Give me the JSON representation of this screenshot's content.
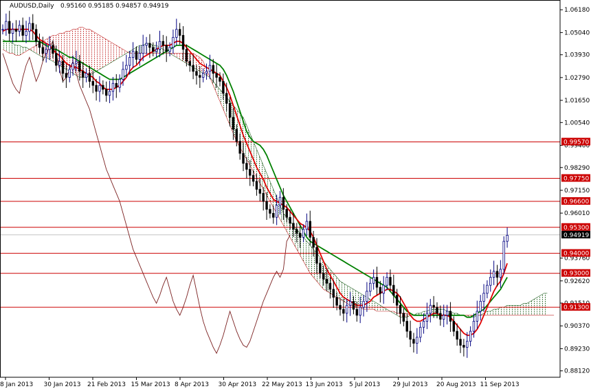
{
  "header": {
    "symbol": "AUDUSD,Daily",
    "ohlc": "0.95160 0.95185 0.94857 0.94919"
  },
  "colors": {
    "background": "#ffffff",
    "axis": "#000000",
    "candle_up": "#000080",
    "candle_down": "#000000",
    "tenkan": "#e00000",
    "kijun": "#008000",
    "chikou": "#7a1f1f",
    "cloud_red": "#c02020",
    "cloud_green": "#206020",
    "level_line": "#cc0000",
    "level_label_bg": "#cc0000",
    "price_label_bg": "#000000"
  },
  "chart_data": {
    "type": "line",
    "title": "",
    "xlabel": "",
    "ylabel": "",
    "ylim": [
      0.878,
      1.066
    ],
    "y_ticks": [
      "1.06180",
      "1.05040",
      "1.03930",
      "1.02790",
      "1.01650",
      "1.00540",
      "0.99400",
      "0.98290",
      "0.97150",
      "0.96010",
      "0.94919",
      "0.93760",
      "0.92620",
      "0.91510",
      "0.90370",
      "0.89230",
      "0.88120"
    ],
    "x_tick_labels": [
      "8 Jan 2013",
      "30 Jan 2013",
      "21 Feb 2013",
      "15 Mar 2013",
      "8 Apr 2013",
      "30 Apr 2013",
      "22 May 2013",
      "13 Jun 2013",
      "5 Jul 2013",
      "29 Jul 2013",
      "20 Aug 2013",
      "11 Sep 2013"
    ],
    "levels": [
      {
        "label": "0.99570",
        "value": 0.9957
      },
      {
        "label": "0.97750",
        "value": 0.9775
      },
      {
        "label": "0.96600",
        "value": 0.966
      },
      {
        "label": "0.95300",
        "value": 0.953
      },
      {
        "label": "0.94000",
        "value": 0.94
      },
      {
        "label": "0.93000",
        "value": 0.93
      },
      {
        "label": "0.91300",
        "value": 0.913
      }
    ],
    "current_price": {
      "label": "0.94919",
      "value": 0.94919
    },
    "series": [
      {
        "key": "close",
        "values": [
          1.052,
          1.056,
          1.05,
          1.052,
          1.051,
          1.054,
          1.049,
          1.051,
          1.055,
          1.052,
          1.046,
          1.043,
          1.04,
          1.042,
          1.044,
          1.04,
          1.034,
          1.036,
          1.03,
          1.028,
          1.032,
          1.035,
          1.036,
          1.031,
          1.028,
          1.03,
          1.026,
          1.024,
          1.021,
          1.024,
          1.022,
          1.019,
          1.021,
          1.025,
          1.023,
          1.027,
          1.032,
          1.034,
          1.038,
          1.041,
          1.037,
          1.04,
          1.044,
          1.045,
          1.043,
          1.041,
          1.042,
          1.046,
          1.044,
          1.041,
          1.043,
          1.048,
          1.052,
          1.049,
          1.042,
          1.036,
          1.034,
          1.031,
          1.029,
          1.028,
          1.03,
          1.031,
          1.034,
          1.03,
          1.028,
          1.026,
          1.02,
          1.015,
          1.008,
          1.002,
          0.996,
          0.99,
          0.985,
          0.982,
          0.979,
          0.976,
          0.972,
          0.97,
          0.966,
          0.962,
          0.96,
          0.958,
          0.964,
          0.968,
          0.962,
          0.958,
          0.955,
          0.952,
          0.95,
          0.948,
          0.952,
          0.956,
          0.948,
          0.943,
          0.935,
          0.93,
          0.927,
          0.925,
          0.922,
          0.918,
          0.914,
          0.912,
          0.91,
          0.914,
          0.916,
          0.912,
          0.909,
          0.913,
          0.916,
          0.921,
          0.925,
          0.928,
          0.923,
          0.92,
          0.924,
          0.928,
          0.924,
          0.919,
          0.914,
          0.91,
          0.906,
          0.901,
          0.897,
          0.895,
          0.898,
          0.903,
          0.906,
          0.91,
          0.914,
          0.913,
          0.91,
          0.907,
          0.909,
          0.911,
          0.906,
          0.901,
          0.897,
          0.894,
          0.893,
          0.896,
          0.901,
          0.906,
          0.911,
          0.916,
          0.92,
          0.924,
          0.928,
          0.931,
          0.928,
          0.932,
          0.946,
          0.949
        ]
      },
      {
        "key": "tenkan",
        "values": [
          1.051,
          1.052,
          1.052,
          1.052,
          1.052,
          1.052,
          1.052,
          1.052,
          1.052,
          1.051,
          1.049,
          1.047,
          1.046,
          1.045,
          1.044,
          1.042,
          1.04,
          1.039,
          1.037,
          1.035,
          1.034,
          1.033,
          1.033,
          1.032,
          1.031,
          1.03,
          1.029,
          1.028,
          1.026,
          1.025,
          1.023,
          1.022,
          1.022,
          1.022,
          1.023,
          1.024,
          1.026,
          1.028,
          1.031,
          1.033,
          1.034,
          1.036,
          1.038,
          1.039,
          1.04,
          1.041,
          1.042,
          1.043,
          1.044,
          1.044,
          1.044,
          1.045,
          1.046,
          1.046,
          1.045,
          1.043,
          1.041,
          1.039,
          1.037,
          1.035,
          1.034,
          1.033,
          1.032,
          1.031,
          1.03,
          1.029,
          1.026,
          1.023,
          1.019,
          1.014,
          1.009,
          1.004,
          0.999,
          0.995,
          0.991,
          0.987,
          0.983,
          0.98,
          0.977,
          0.973,
          0.97,
          0.967,
          0.966,
          0.965,
          0.964,
          0.963,
          0.961,
          0.959,
          0.957,
          0.955,
          0.954,
          0.953,
          0.951,
          0.948,
          0.944,
          0.94,
          0.936,
          0.932,
          0.929,
          0.926,
          0.923,
          0.92,
          0.918,
          0.917,
          0.916,
          0.915,
          0.914,
          0.914,
          0.914,
          0.915,
          0.916,
          0.918,
          0.919,
          0.92,
          0.921,
          0.922,
          0.922,
          0.921,
          0.92,
          0.918,
          0.915,
          0.912,
          0.909,
          0.907,
          0.906,
          0.906,
          0.907,
          0.908,
          0.909,
          0.91,
          0.91,
          0.909,
          0.909,
          0.909,
          0.908,
          0.906,
          0.904,
          0.902,
          0.9,
          0.899,
          0.899,
          0.9,
          0.902,
          0.905,
          0.909,
          0.913,
          0.917,
          0.921,
          0.924,
          0.926,
          0.93,
          0.935
        ]
      },
      {
        "key": "kijun",
        "values": [
          1.046,
          1.046,
          1.046,
          1.046,
          1.046,
          1.046,
          1.046,
          1.046,
          1.046,
          1.046,
          1.046,
          1.046,
          1.045,
          1.044,
          1.043,
          1.042,
          1.042,
          1.041,
          1.04,
          1.039,
          1.038,
          1.038,
          1.037,
          1.036,
          1.035,
          1.034,
          1.033,
          1.032,
          1.031,
          1.03,
          1.029,
          1.028,
          1.027,
          1.027,
          1.027,
          1.027,
          1.028,
          1.029,
          1.03,
          1.031,
          1.032,
          1.033,
          1.034,
          1.035,
          1.036,
          1.037,
          1.038,
          1.039,
          1.04,
          1.041,
          1.042,
          1.043,
          1.044,
          1.044,
          1.044,
          1.044,
          1.043,
          1.042,
          1.041,
          1.04,
          1.039,
          1.038,
          1.037,
          1.036,
          1.035,
          1.034,
          1.032,
          1.029,
          1.025,
          1.021,
          1.016,
          1.011,
          1.006,
          1.001,
          0.998,
          0.996,
          0.995,
          0.994,
          0.992,
          0.989,
          0.985,
          0.981,
          0.977,
          0.973,
          0.969,
          0.966,
          0.963,
          0.96,
          0.957,
          0.954,
          0.951,
          0.948,
          0.946,
          0.945,
          0.944,
          0.943,
          0.942,
          0.941,
          0.94,
          0.939,
          0.938,
          0.937,
          0.936,
          0.935,
          0.934,
          0.933,
          0.932,
          0.931,
          0.93,
          0.929,
          0.928,
          0.927,
          0.926,
          0.925,
          0.924,
          0.923,
          0.921,
          0.919,
          0.917,
          0.915,
          0.913,
          0.911,
          0.91,
          0.909,
          0.909,
          0.909,
          0.909,
          0.909,
          0.909,
          0.909,
          0.909,
          0.909,
          0.909,
          0.909,
          0.909,
          0.909,
          0.909,
          0.909,
          0.909,
          0.908,
          0.908,
          0.909,
          0.91,
          0.911,
          0.912,
          0.914,
          0.916,
          0.918,
          0.92,
          0.922,
          0.925,
          0.928
        ]
      },
      {
        "key": "chikou",
        "values": [
          1.04,
          1.035,
          1.03,
          1.025,
          1.022,
          1.02,
          1.028,
          1.034,
          1.038,
          1.032,
          1.026,
          1.03,
          1.036,
          1.04,
          1.043,
          1.046,
          1.04,
          1.032,
          1.026,
          1.028,
          1.032,
          1.036,
          1.03,
          1.024,
          1.02,
          1.016,
          1.012,
          1.006,
          1.0,
          0.994,
          0.988,
          0.982,
          0.978,
          0.974,
          0.97,
          0.966,
          0.96,
          0.954,
          0.948,
          0.942,
          0.938,
          0.934,
          0.93,
          0.926,
          0.922,
          0.918,
          0.915,
          0.919,
          0.924,
          0.928,
          0.922,
          0.916,
          0.912,
          0.909,
          0.913,
          0.918,
          0.924,
          0.929,
          0.921,
          0.913,
          0.906,
          0.901,
          0.897,
          0.893,
          0.89,
          0.894,
          0.899,
          0.905,
          0.911,
          0.906,
          0.901,
          0.897,
          0.894,
          0.893,
          0.896,
          0.901,
          0.906,
          0.911,
          0.916,
          0.92,
          0.924,
          0.928,
          0.931,
          0.928,
          0.932,
          0.946,
          0.949
        ]
      },
      {
        "key": "span_a",
        "values": [
          1.047,
          1.046,
          1.046,
          1.045,
          1.044,
          1.044,
          1.043,
          1.043,
          1.042,
          1.041,
          1.04,
          1.039,
          1.038,
          1.038,
          1.037,
          1.036,
          1.035,
          1.034,
          1.033,
          1.032,
          1.031,
          1.03,
          1.029,
          1.028,
          1.028,
          1.028,
          1.029,
          1.03,
          1.031,
          1.032,
          1.033,
          1.034,
          1.035,
          1.036,
          1.037,
          1.038,
          1.039,
          1.04,
          1.041,
          1.042,
          1.043,
          1.044,
          1.044,
          1.045,
          1.045,
          1.044,
          1.044,
          1.043,
          1.042,
          1.041,
          1.04,
          1.039,
          1.038,
          1.037,
          1.036,
          1.035,
          1.034,
          1.033,
          1.032,
          1.031,
          1.03,
          1.029,
          1.028,
          1.026,
          1.024,
          1.022,
          1.02,
          1.018,
          1.016,
          1.014,
          1.012,
          1.01,
          1.008,
          1.004,
          1.0,
          0.996,
          0.992,
          0.988,
          0.984,
          0.98,
          0.976,
          0.972,
          0.968,
          0.964,
          0.96,
          0.958,
          0.956,
          0.954,
          0.952,
          0.95,
          0.948,
          0.946,
          0.944,
          0.942,
          0.94,
          0.938,
          0.936,
          0.934,
          0.932,
          0.93,
          0.928,
          0.926,
          0.925,
          0.924,
          0.923,
          0.922,
          0.921,
          0.92,
          0.919,
          0.918,
          0.917,
          0.916,
          0.915,
          0.914,
          0.913,
          0.912,
          0.911,
          0.91,
          0.909,
          0.908,
          0.908,
          0.908,
          0.909,
          0.909,
          0.91,
          0.91,
          0.911,
          0.911,
          0.912,
          0.912,
          0.912,
          0.912,
          0.912,
          0.911,
          0.911,
          0.91,
          0.91,
          0.909,
          0.909,
          0.909,
          0.908,
          0.908,
          0.909,
          0.909,
          0.91,
          0.911,
          0.911,
          0.912,
          0.912,
          0.913,
          0.913,
          0.914,
          0.914,
          0.914,
          0.914,
          0.914,
          0.915,
          0.915,
          0.916,
          0.917,
          0.918,
          0.919,
          0.92,
          0.92
        ]
      },
      {
        "key": "span_b",
        "values": [
          1.042,
          1.041,
          1.04,
          1.04,
          1.039,
          1.039,
          1.04,
          1.041,
          1.042,
          1.043,
          1.044,
          1.045,
          1.046,
          1.047,
          1.048,
          1.049,
          1.049,
          1.05,
          1.05,
          1.051,
          1.051,
          1.052,
          1.052,
          1.053,
          1.053,
          1.052,
          1.052,
          1.051,
          1.05,
          1.049,
          1.048,
          1.047,
          1.046,
          1.045,
          1.044,
          1.043,
          1.042,
          1.041,
          1.04,
          1.04,
          1.04,
          1.04,
          1.04,
          1.04,
          1.04,
          1.04,
          1.04,
          1.04,
          1.04,
          1.04,
          1.04,
          1.04,
          1.04,
          1.04,
          1.04,
          1.04,
          1.04,
          1.04,
          1.039,
          1.038,
          1.036,
          1.032,
          1.028,
          1.024,
          1.02,
          1.016,
          1.012,
          1.008,
          1.004,
          1.0,
          0.996,
          0.993,
          0.99,
          0.987,
          0.984,
          0.981,
          0.978,
          0.975,
          0.972,
          0.969,
          0.966,
          0.963,
          0.96,
          0.957,
          0.954,
          0.951,
          0.948,
          0.945,
          0.942,
          0.939,
          0.936,
          0.933,
          0.93,
          0.928,
          0.926,
          0.924,
          0.922,
          0.921,
          0.92,
          0.919,
          0.918,
          0.917,
          0.916,
          0.915,
          0.914,
          0.914,
          0.913,
          0.913,
          0.912,
          0.912,
          0.912,
          0.912,
          0.911,
          0.911,
          0.911,
          0.911,
          0.911,
          0.911,
          0.91,
          0.91,
          0.91,
          0.91,
          0.909,
          0.909,
          0.909,
          0.909,
          0.909,
          0.909,
          0.909,
          0.909,
          0.909,
          0.909,
          0.909,
          0.909,
          0.909,
          0.909,
          0.909,
          0.909,
          0.909,
          0.909,
          0.909,
          0.909,
          0.909,
          0.909,
          0.909,
          0.909,
          0.909,
          0.909,
          0.909,
          0.909,
          0.909,
          0.909,
          0.909,
          0.909,
          0.909,
          0.909,
          0.909,
          0.909,
          0.909,
          0.909,
          0.909,
          0.909,
          0.909,
          0.909,
          0.909,
          0.909
        ]
      }
    ]
  }
}
